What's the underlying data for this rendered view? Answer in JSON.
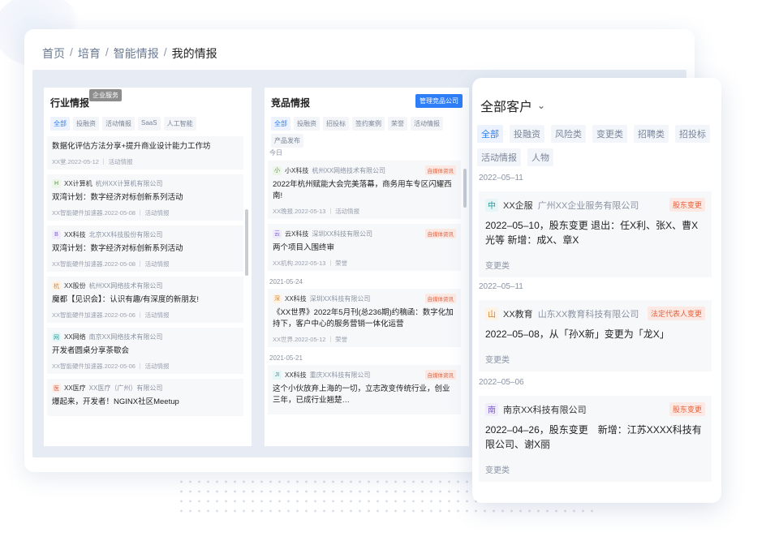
{
  "breadcrumb": [
    "首页",
    "培育",
    "智能情报",
    "我的情报"
  ],
  "industry": {
    "title": "行业情报",
    "tag": "企业服务",
    "tabs": [
      "全部",
      "投融资",
      "活动情报",
      "SaaS",
      "人工智能"
    ],
    "items": [
      {
        "avatar": "",
        "name": "",
        "company": "",
        "title": "数据化评估方法分享+提升商业设计能力工作坊",
        "meta": "XX堂.2022-05-12 ｜ 活动情报"
      },
      {
        "avatar": "H",
        "name": "XX计算机",
        "company": "杭州XX计算机有限公司",
        "title": "双湾计划：数字经济对标创新系列活动",
        "meta": "XX智能硬件加速器.2022-05-08 ｜ 活动情报"
      },
      {
        "avatar": "B",
        "name": "XX科技",
        "company": "北京XX科技股份有限公司",
        "title": "双湾计划：数字经济对标创新系列活动",
        "meta": "XX智能硬件加速器.2022-05-08 ｜ 活动情报"
      },
      {
        "avatar": "杭",
        "name": "XX股份",
        "company": "杭州XX网络技术有限公司",
        "title": "魔都【见识会】：认识有趣/有深度的新朋友!",
        "meta": "XX智能硬件加速器.2022-05-06 ｜ 活动情报"
      },
      {
        "avatar": "网",
        "name": "XX网络",
        "company": "南京XX网络技术有限公司",
        "title": "开发者圆桌分享茶歇会",
        "meta": "XX智能硬件加速器.2022-05-06 ｜ 活动情报"
      },
      {
        "avatar": "医",
        "name": "XX医疗",
        "company": "XX医疗（广州）有限公司",
        "title": "爆起来，开发者！NGINX社区Meetup",
        "meta": ""
      }
    ]
  },
  "competitor": {
    "title": "竞品情报",
    "manage": "管理竞品公司",
    "tabs": [
      "全部",
      "投融资",
      "招投标",
      "签约案例",
      "荣誉",
      "活动情报",
      "产品发布"
    ],
    "groups": [
      {
        "date": "今日",
        "items": [
          {
            "avatar": "小",
            "name": "小X科技",
            "company": "杭州XX网络技术有限公司",
            "badge": "自媒体资讯",
            "title": "2022年杭州赋能大会完美落幕，商务用车专区闪耀西南!",
            "meta": "XX晚报.2022-05-13 ｜ 活动情报"
          },
          {
            "avatar": "云",
            "name": "云X科技",
            "company": "深圳XX科技有限公司",
            "badge": "自媒体资讯",
            "title": "两个项目入围终审",
            "meta": "XX机构.2022-05-13 ｜ 荣誉"
          }
        ]
      },
      {
        "date": "2021-05-24",
        "items": [
          {
            "avatar": "深",
            "name": "XX科技",
            "company": "深圳XX科技有限公司",
            "badge": "自媒体资讯",
            "title": "《XX世界》2022年5月刊(总236期)约稿函：数字化加持下，客户中心的服务营销一体化运营",
            "meta": "XX世界.2022-05-12 ｜ 荣誉"
          }
        ]
      },
      {
        "date": "2021-05-21",
        "items": [
          {
            "avatar": "JI",
            "name": "XX科技",
            "company": "重庆XX科技有限公司",
            "badge": "自媒体资讯",
            "title": "这个小伙放弃上海的一切，立志改变传统行业，创业三年，已成行业翘楚…",
            "meta": ""
          }
        ]
      }
    ]
  },
  "customers": {
    "title": "全部客户",
    "tabs": [
      "全部",
      "投融资",
      "风险类",
      "变更类",
      "招聘类",
      "招投标",
      "活动情报",
      "人物"
    ],
    "items": [
      {
        "date": "2022–05–11",
        "avatar": "中",
        "name": "XX企服",
        "company": "广州XX企业服务有限公司",
        "badge": "股东变更",
        "body": "2022–05–10，股东变更 退出：任X利、张X、曹X光等 新增：成X、章X",
        "foot": "变更类"
      },
      {
        "date": "2022–05–11",
        "avatar": "山",
        "name": "XX教育",
        "company": "山东XX教育科技有限公司",
        "badge": "法定代表人变更",
        "body": "2022–05–08，从「孙X新」变更为「龙X」",
        "foot": "变更类"
      },
      {
        "date": "2022–05–06",
        "avatar": "南",
        "name": "南京XX科技有限公司",
        "company": "",
        "badge": "股东变更",
        "body": "2022–04–26，股东变更　新增：江苏XXXX科技有限公司、谢X丽",
        "foot": "变更类"
      }
    ]
  },
  "colors": {
    "accent": "#2d7ef7",
    "badge_text": "#e2623e",
    "badge_bg": "#fde9e3"
  }
}
